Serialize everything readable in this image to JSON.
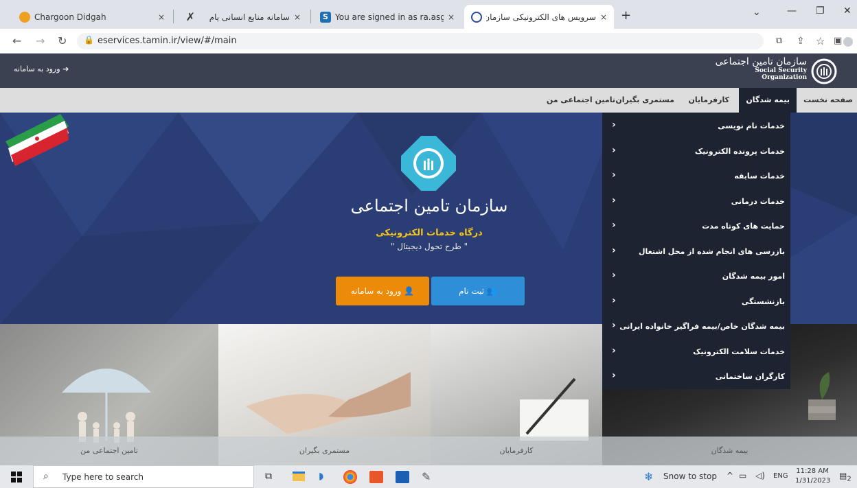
{
  "browser": {
    "tabs": [
      {
        "title": "Chargoon Didgah",
        "close": "×"
      },
      {
        "title": "سامانه منابع انسانی یام",
        "close": "×"
      },
      {
        "title": "You are signed in as ra.asghari",
        "close": "×"
      },
      {
        "title": "سرویس های الکترونیکی سازمان تام",
        "close": "×"
      }
    ],
    "new_tab": "+",
    "url": "eservices.tamin.ir/view/#/main",
    "window_controls": {
      "dropdown": "⌄",
      "minimize": "—",
      "restore": "❐",
      "close": "✕"
    }
  },
  "site": {
    "login_link": "ورود به سامانه",
    "org_name_fa": "سازمان تامین اجتماعی",
    "org_name_en": "Social Security Organization",
    "menu": [
      "صفحه نخست",
      "بیمه شدگان",
      "کارفرمایان",
      "مستمری بگیران",
      "تامین اجتماعی من"
    ],
    "active_menu": "بیمه شدگان",
    "dropdown": [
      "خدمات نام نویسی",
      "خدمات پرونده الکترونیک",
      "خدمات سابقه",
      "خدمات درمانی",
      "حمایت های کوتاه مدت",
      "بازرسی های انجام شده از محل اشتغال",
      "امور بیمه شدگان",
      "بازنشستگی",
      "بیمه شدگان خاص/بیمه فراگیر خانواده ایرانی",
      "خدمات سلامت الکترونیک",
      "کارگران ساختمانی"
    ],
    "hero": {
      "title": "سازمان تامین اجتماعی",
      "subtitle": "درگاه خدمات الکترونیکی",
      "tagline": "\" طرح تحول دیجیتال \"",
      "register_button": "ثبت نام",
      "login_button": "ورود به سامانه"
    },
    "tiles": [
      "تامین اجتماعی من",
      "مستمری بگیران",
      "کارفرمایان",
      "بیمه شدگان"
    ],
    "colors": {
      "header": "#3b4150",
      "menu_active": "#1d2330",
      "register": "#2e8fd8",
      "login": "#ec8a0a",
      "hero": "#2b3d75",
      "subtitle": "#f5c518"
    }
  },
  "taskbar": {
    "search_placeholder": "Type here to search",
    "weather": "Snow to stop",
    "lang": "ENG",
    "time": "11:28 AM",
    "date": "1/31/2023",
    "notif_count": "2"
  }
}
